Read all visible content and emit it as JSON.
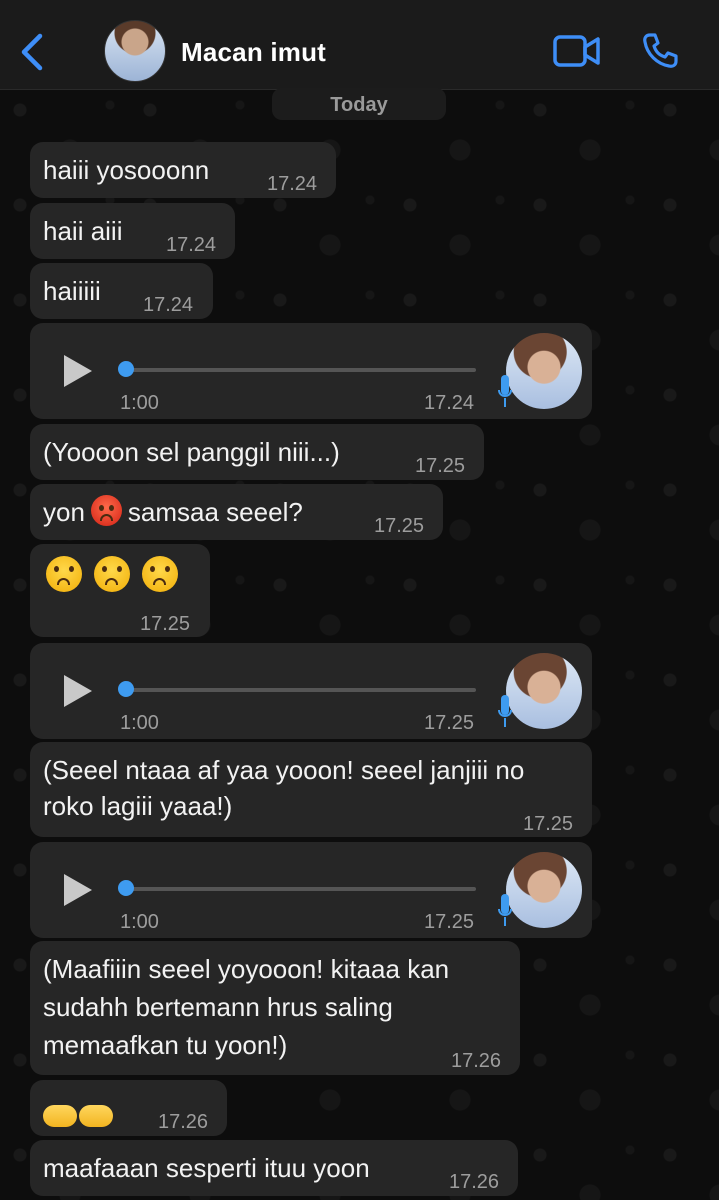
{
  "header": {
    "contact_name": "Macan imut",
    "back_icon": "chevron-left-icon",
    "video_icon": "video-camera-icon",
    "call_icon": "phone-icon",
    "accent_color": "#3e8ef7"
  },
  "date_separator": "Today",
  "messages": [
    {
      "text": "haiii yosooonn",
      "time": "17.24"
    },
    {
      "text": "haii aiii",
      "time": "17.24"
    },
    {
      "text": "haiiiii",
      "time": "17.24"
    },
    {
      "type": "voice",
      "duration": "1:00",
      "time": "17.24"
    },
    {
      "text": "(Yoooon sel panggil niii...)",
      "time": "17.25"
    },
    {
      "text_before": "yon",
      "emoji": "angry-face",
      "text_after": "samsaa seeel?",
      "time": "17.25"
    },
    {
      "emojis": [
        "frowning-face",
        "frowning-face",
        "frowning-face"
      ],
      "time": "17.25"
    },
    {
      "type": "voice",
      "duration": "1:00",
      "time": "17.25"
    },
    {
      "lines": [
        "(Seeel ntaaa af yaa yooon! seeel janjiii no",
        "roko lagiii yaaa!)"
      ],
      "time": "17.25"
    },
    {
      "type": "voice",
      "duration": "1:00",
      "time": "17.25"
    },
    {
      "lines": [
        "(Maafiiin seeel yoyooon! kitaaa kan",
        "sudahh bertemann hrus saling",
        "memaafkan tu yoon!)"
      ],
      "time": "17.26"
    },
    {
      "emojis": [
        "right-hand",
        "left-hand"
      ],
      "time": "17.26"
    },
    {
      "text": "maafaaan sesperti ituu yoon",
      "time": "17.26"
    }
  ]
}
